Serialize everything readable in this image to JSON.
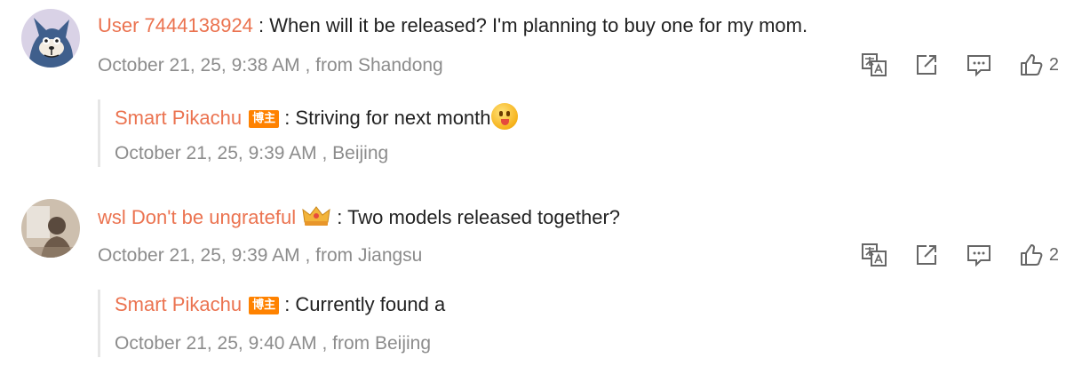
{
  "comments": [
    {
      "user": "User 7444138924",
      "separator": " : ",
      "text": "When will it be released? I'm planning to buy one for my mom.",
      "meta": "October 21, 25, 9:38 AM , from Shandong",
      "likes": "2",
      "reply": {
        "user": "Smart Pikachu",
        "badge": "博主",
        "separator": " : ",
        "text": "Striving for next month",
        "meta": "October 21, 25, 9:39 AM , Beijing"
      }
    },
    {
      "user": "wsl Don't be ungrateful",
      "separator": " : ",
      "text": "Two models released together?",
      "meta": "October 21, 25, 9:39 AM , from Jiangsu",
      "likes": "2",
      "reply": {
        "user": "Smart Pikachu",
        "badge": "博主",
        "separator": " : ",
        "text": "Currently found a",
        "meta": "October 21, 25, 9:40 AM , from Beijing"
      }
    }
  ],
  "icons": {
    "translate": "translate-icon",
    "share": "share-icon",
    "comment": "comment-icon",
    "like": "thumbs-up-icon",
    "emoji": "tongue-out-emoji-icon",
    "crown": "crown-badge-icon"
  },
  "colors": {
    "username": "#eb7350",
    "meta": "#8c8c8c",
    "badge": "#ff8200",
    "text": "#222222"
  }
}
